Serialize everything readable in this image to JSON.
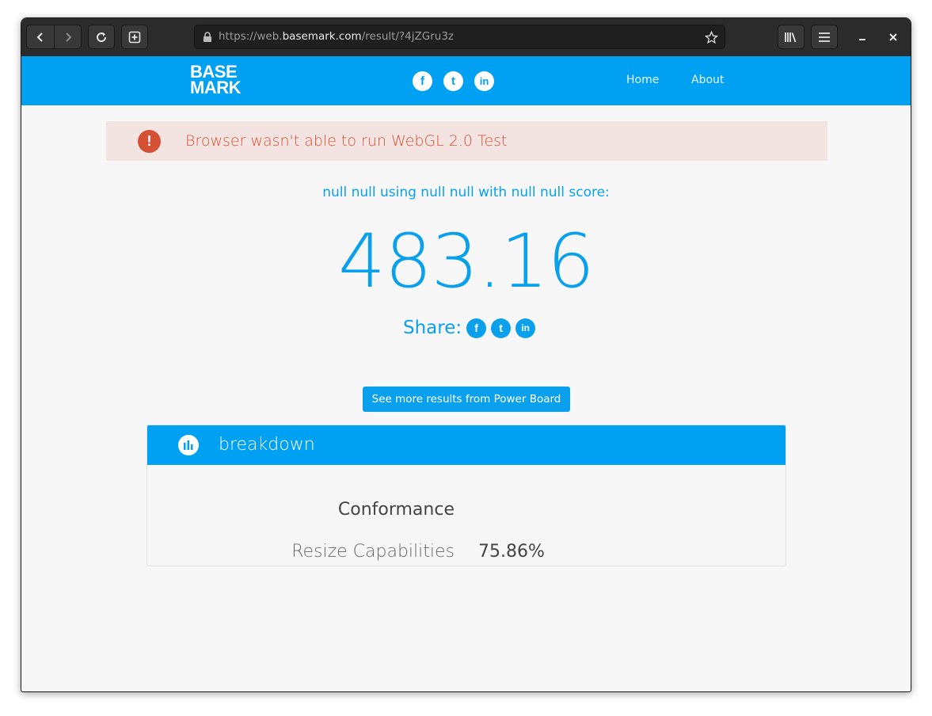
{
  "browser": {
    "url_prefix": "https://web.",
    "url_host": "basemark.com",
    "url_path": "/result/?4jZGru3z"
  },
  "site": {
    "logo_line1": "BASE",
    "logo_line2": "MARK",
    "nav": {
      "home": "Home",
      "about": "About"
    },
    "social": {
      "facebook": "f",
      "twitter": "t",
      "linkedin": "in"
    }
  },
  "alert": {
    "icon": "!",
    "message": "Browser wasn't able to run WebGL 2.0 Test"
  },
  "result": {
    "subtitle": "null null using null null with null null score:",
    "score": "483.16",
    "share_label": "Share:",
    "power_board_button": "See more results from Power Board"
  },
  "breakdown": {
    "title": "breakdown",
    "section_heading": "Conformance",
    "rows": [
      {
        "label": "Resize Capabilities",
        "value": "75.86%"
      }
    ]
  },
  "colors": {
    "brand_blue": "#00a0f2",
    "alert_red": "#d55134",
    "alert_bg": "#f3e4e2"
  }
}
